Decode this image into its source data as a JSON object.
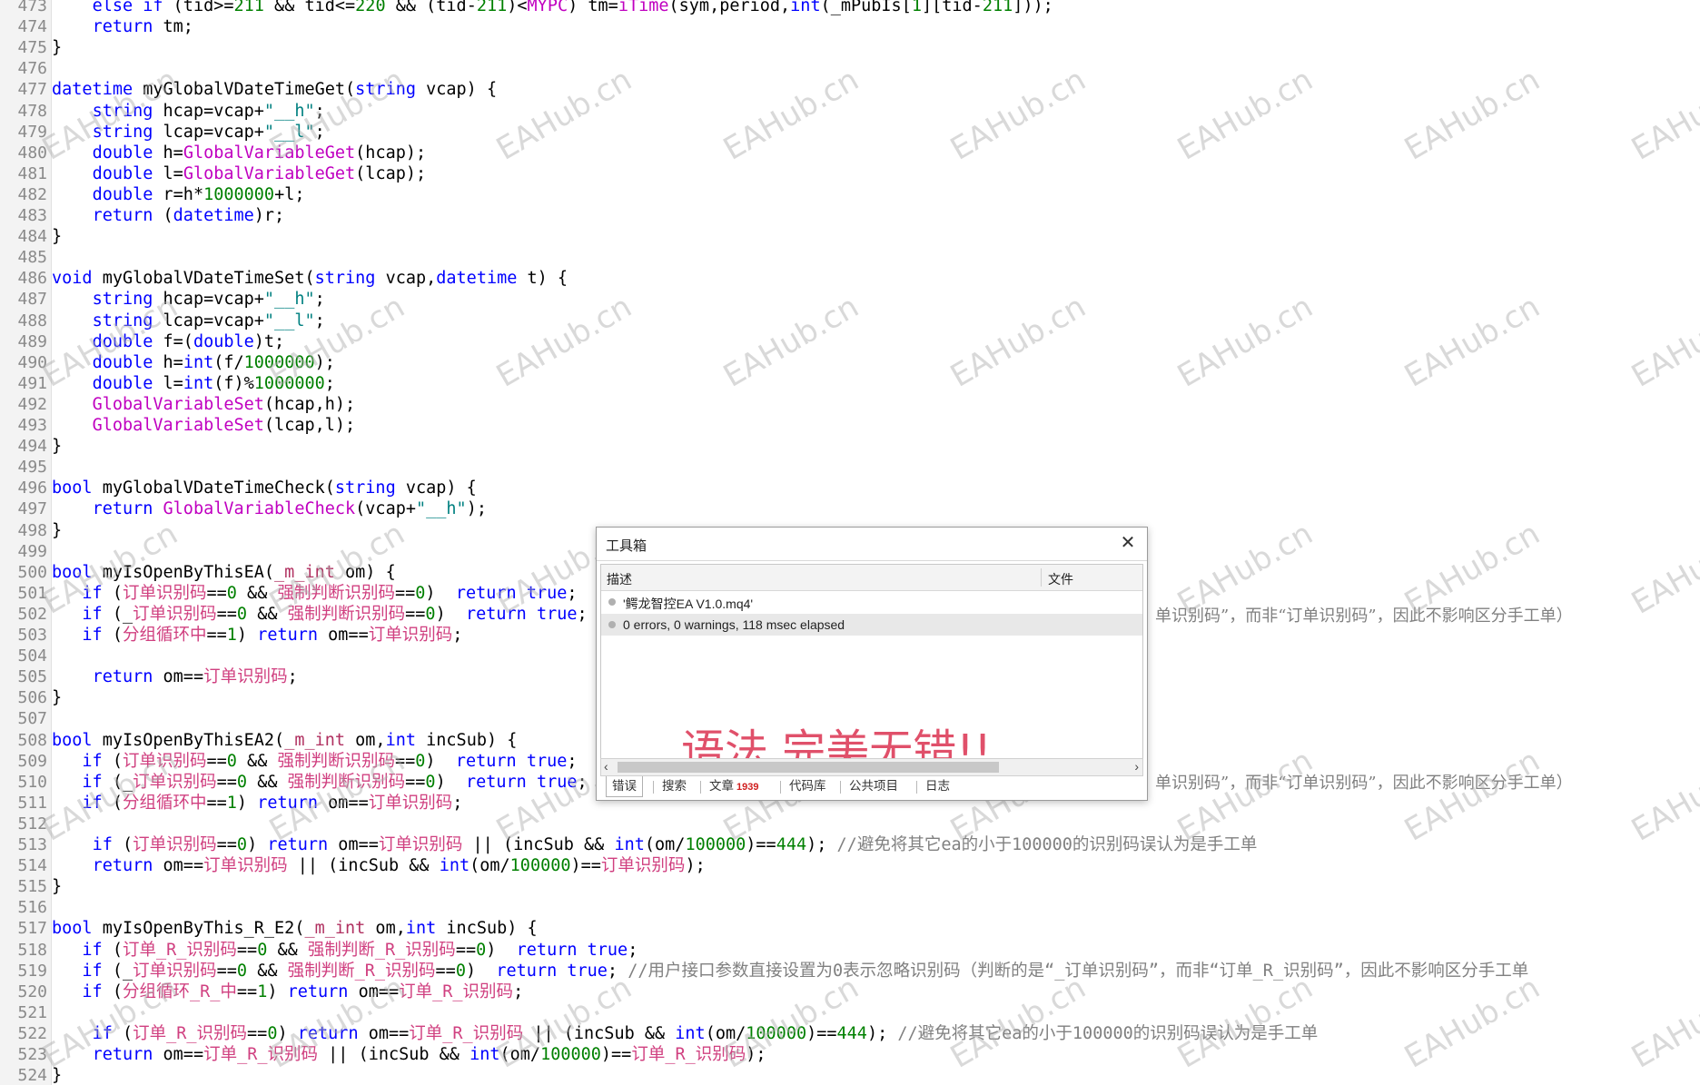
{
  "editor": {
    "lines": [
      {
        "n": "473",
        "html": "    <span class='kw'>else if</span> (tid>=<span class='num'>211</span> && tid<=<span class='num'>220</span> && (tid-<span class='num'>211</span>)<<span class='fn'>MYPC</span>) tm=<span class='fn'>iTime</span>(sym,period,<span class='kw'>int</span>(_mPubIs[<span class='num'>1</span>][tid-<span class='num'>211</span>]));"
      },
      {
        "n": "474",
        "html": "    <span class='kw'>return</span> tm;"
      },
      {
        "n": "475",
        "html": "}"
      },
      {
        "n": "476",
        "html": ""
      },
      {
        "n": "477",
        "html": "<span class='kw'>datetime</span> myGlobalVDateTimeGet(<span class='kw'>string</span> vcap) {"
      },
      {
        "n": "478",
        "html": "    <span class='kw'>string</span> hcap=vcap+<span class='str'>\"__h\"</span>;"
      },
      {
        "n": "479",
        "html": "    <span class='kw'>string</span> lcap=vcap+<span class='str'>\"__l\"</span>;"
      },
      {
        "n": "480",
        "html": "    <span class='kw'>double</span> h=<span class='fn'>GlobalVariableGet</span>(hcap);"
      },
      {
        "n": "481",
        "html": "    <span class='kw'>double</span> l=<span class='fn'>GlobalVariableGet</span>(lcap);"
      },
      {
        "n": "482",
        "html": "    <span class='kw'>double</span> r=h*<span class='num'>1000000</span>+l;"
      },
      {
        "n": "483",
        "html": "    <span class='kw'>return</span> (<span class='kw'>datetime</span>)r;"
      },
      {
        "n": "484",
        "html": "}"
      },
      {
        "n": "485",
        "html": ""
      },
      {
        "n": "486",
        "html": "<span class='kw'>void</span> myGlobalVDateTimeSet(<span class='kw'>string</span> vcap,<span class='kw'>datetime</span> t) {"
      },
      {
        "n": "487",
        "html": "    <span class='kw'>string</span> hcap=vcap+<span class='str'>\"__h\"</span>;"
      },
      {
        "n": "488",
        "html": "    <span class='kw'>string</span> lcap=vcap+<span class='str'>\"__l\"</span>;"
      },
      {
        "n": "489",
        "html": "    <span class='kw'>double</span> f=(<span class='kw'>double</span>)t;"
      },
      {
        "n": "490",
        "html": "    <span class='kw'>double</span> h=<span class='kw'>int</span>(f/<span class='num'>1000000</span>);"
      },
      {
        "n": "491",
        "html": "    <span class='kw'>double</span> l=<span class='kw'>int</span>(f)%<span class='num'>1000000</span>;"
      },
      {
        "n": "492",
        "html": "    <span class='fn'>GlobalVariableSet</span>(hcap,h);"
      },
      {
        "n": "493",
        "html": "    <span class='fn'>GlobalVariableSet</span>(lcap,l);"
      },
      {
        "n": "494",
        "html": "}"
      },
      {
        "n": "495",
        "html": ""
      },
      {
        "n": "496",
        "html": "<span class='kw'>bool</span> myGlobalVDateTimeCheck(<span class='kw'>string</span> vcap) {"
      },
      {
        "n": "497",
        "html": "    <span class='kw'>return</span> <span class='fn'>GlobalVariableCheck</span>(vcap+<span class='str'>\"__h\"</span>);"
      },
      {
        "n": "498",
        "html": "}"
      },
      {
        "n": "499",
        "html": ""
      },
      {
        "n": "500",
        "html": "<span class='kw'>bool</span> myIsOpenByThisEA(<span class='typ'>_m_int</span> om) {"
      },
      {
        "n": "501",
        "html": "   <span class='kw'>if</span> (<span class='zh'>订单识别码</span>==<span class='num'>0</span> && <span class='zh'>强制判断识别码</span>==<span class='num'>0</span>)  <span class='kw'>return</span> <span class='kw'>true</span>;"
      },
      {
        "n": "502",
        "html": "   <span class='kw'>if</span> (_<span class='zh'>订单识别码</span>==<span class='num'>0</span> && <span class='zh'>强制判断识别码</span>==<span class='num'>0</span>)  <span class='kw'>return</span> <span class='kw'>true</span>;"
      },
      {
        "n": "503",
        "html": "   <span class='kw'>if</span> (<span class='zh'>分组循环中</span>==<span class='num'>1</span>) <span class='kw'>return</span> om==<span class='zh'>订单识别码</span>;"
      },
      {
        "n": "504",
        "html": ""
      },
      {
        "n": "505",
        "html": "    <span class='kw'>return</span> om==<span class='zh'>订单识别码</span>;"
      },
      {
        "n": "506",
        "html": "}"
      },
      {
        "n": "507",
        "html": ""
      },
      {
        "n": "508",
        "html": "<span class='kw'>bool</span> myIsOpenByThisEA2(<span class='typ'>_m_int</span> om,<span class='kw'>int</span> incSub) {"
      },
      {
        "n": "509",
        "html": "   <span class='kw'>if</span> (<span class='zh'>订单识别码</span>==<span class='num'>0</span> && <span class='zh'>强制判断识别码</span>==<span class='num'>0</span>)  <span class='kw'>return</span> <span class='kw'>true</span>;"
      },
      {
        "n": "510",
        "html": "   <span class='kw'>if</span> (_<span class='zh'>订单识别码</span>==<span class='num'>0</span> && <span class='zh'>强制判断识别码</span>==<span class='num'>0</span>)  <span class='kw'>return</span> <span class='kw'>true</span>;"
      },
      {
        "n": "511",
        "html": "   <span class='kw'>if</span> (<span class='zh'>分组循环中</span>==<span class='num'>1</span>) <span class='kw'>return</span> om==<span class='zh'>订单识别码</span>;"
      },
      {
        "n": "512",
        "html": ""
      },
      {
        "n": "513",
        "html": "    <span class='kw'>if</span> (<span class='zh'>订单识别码</span>==<span class='num'>0</span>) <span class='kw'>return</span> om==<span class='zh'>订单识别码</span> || (incSub && <span class='kw'>int</span>(om/<span class='num'>100000</span>)==<span class='num'>444</span>); <span class='cmt'>//避免将其它ea的小于100000的识别码误认为是手工单</span>"
      },
      {
        "n": "514",
        "html": "    <span class='kw'>return</span> om==<span class='zh'>订单识别码</span> || (incSub && <span class='kw'>int</span>(om/<span class='num'>100000</span>)==<span class='zh'>订单识别码</span>);"
      },
      {
        "n": "515",
        "html": "}"
      },
      {
        "n": "516",
        "html": ""
      },
      {
        "n": "517",
        "html": "<span class='kw'>bool</span> myIsOpenByThis_R_E2(<span class='typ'>_m_int</span> om,<span class='kw'>int</span> incSub) {"
      },
      {
        "n": "518",
        "html": "   <span class='kw'>if</span> (<span class='zh'>订单_R_识别码</span>==<span class='num'>0</span> && <span class='zh'>强制判断_R_识别码</span>==<span class='num'>0</span>)  <span class='kw'>return</span> <span class='kw'>true</span>;"
      },
      {
        "n": "519",
        "html": "   <span class='kw'>if</span> (_<span class='zh'>订单识别码</span>==<span class='num'>0</span> && <span class='zh'>强制判断_R_识别码</span>==<span class='num'>0</span>)  <span class='kw'>return</span> <span class='kw'>true</span>; <span class='cmt'>//用户接口参数直接设置为0表示忽略识别码（判断的是“_订单识别码”，而非“订单_R_识别码”，因此不影响区分手工单</span>"
      },
      {
        "n": "520",
        "html": "   <span class='kw'>if</span> (<span class='zh'>分组循环_R_中</span>==<span class='num'>1</span>) <span class='kw'>return</span> om==<span class='zh'>订单_R_识别码</span>;"
      },
      {
        "n": "521",
        "html": ""
      },
      {
        "n": "522",
        "html": "    <span class='kw'>if</span> (<span class='zh'>订单_R_识别码</span>==<span class='num'>0</span>) <span class='kw'>return</span> om==<span class='zh'>订单_R_识别码</span> || (incSub && <span class='kw'>int</span>(om/<span class='num'>100000</span>)==<span class='num'>444</span>); <span class='cmt'>//避免将其它ea的小于100000的识别码误认为是手工单</span>"
      },
      {
        "n": "523",
        "html": "    <span class='kw'>return</span> om==<span class='zh'>订单_R_识别码</span> || (incSub && <span class='kw'>int</span>(om/<span class='num'>100000</span>)==<span class='zh'>订单_R_识别码</span>);"
      },
      {
        "n": "524",
        "html": "}"
      }
    ],
    "overflow_comment_502": "单识别码”，而非“订单识别码”，因此不影响区分手工单）",
    "overflow_comment_510": "单识别码”，而非“订单识别码”，因此不影响区分手工单）"
  },
  "watermark": "EAHub.cn",
  "dialog": {
    "title": "工具箱",
    "columns": {
      "desc": "描述",
      "file": "文件"
    },
    "rows": [
      "'鳄龙智控EA V1.0.mq4'",
      "0 errors, 0 warnings, 118 msec elapsed"
    ],
    "overlay_text": "语法 完美无错!!",
    "tabs": [
      {
        "label": "错误"
      },
      {
        "label": "搜索"
      },
      {
        "label": "文章",
        "badge": "1939"
      },
      {
        "label": "代码库"
      },
      {
        "label": "公共项目"
      },
      {
        "label": "日志"
      }
    ]
  },
  "colors": {
    "keyword": "#0000ff",
    "function": "#c000c0",
    "string": "#008080",
    "number": "#008000",
    "chinese_ident": "#d04080",
    "comment": "#808080",
    "overlay": "#e0506a"
  }
}
